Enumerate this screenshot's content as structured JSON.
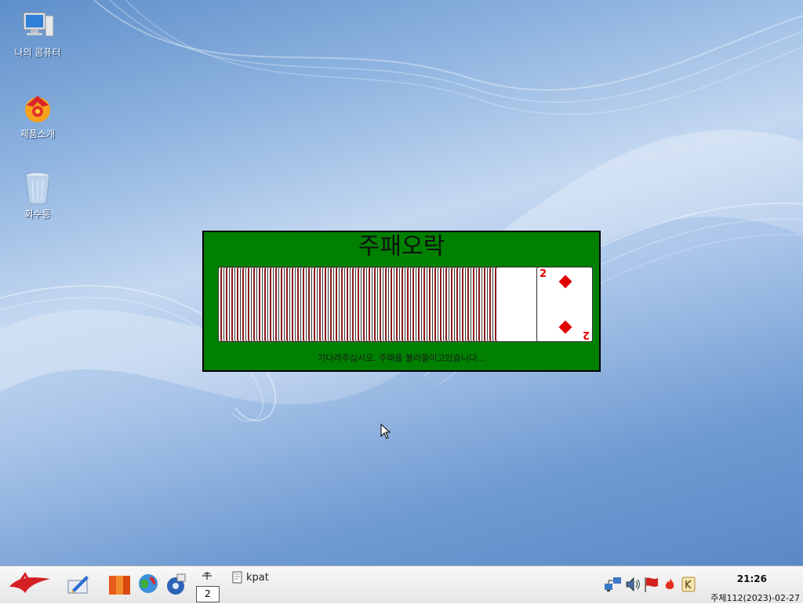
{
  "desktop": {
    "icons": [
      {
        "label": "나의 콤퓨터",
        "icon": "computer-icon"
      },
      {
        "label": "제품소개",
        "icon": "product-intro-icon"
      },
      {
        "label": "회수통",
        "icon": "recycle-bin-icon"
      }
    ]
  },
  "splash": {
    "title": "주패오락",
    "status": "기다려주십시오. 주패를 불러들이고있습니다...",
    "front_card": {
      "rank": "2",
      "suit": "diamonds"
    },
    "colors": {
      "table": "#008000",
      "red_suit": "#e00000"
    }
  },
  "taskbar": {
    "launchers": [
      "start-menu-icon",
      "text-editor-icon",
      "file-manager-icon",
      "web-browser-icon",
      "media-player-icon"
    ],
    "pager_switch_icon": "desktop-switch-icon",
    "pager_number": "2",
    "task_label": "kpat",
    "tray_icons": [
      "network-icon",
      "volume-icon",
      "flag-icon",
      "fire-icon",
      "keyboard-icon"
    ],
    "clock": "21:26",
    "date": "주체112(2023)-02-27"
  }
}
